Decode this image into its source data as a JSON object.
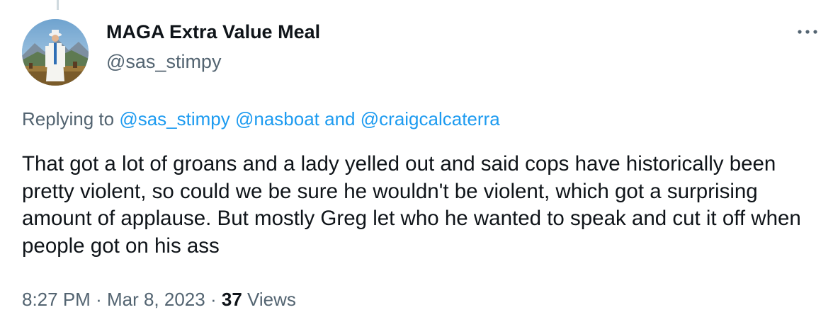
{
  "tweet": {
    "display_name": "MAGA Extra Value Meal",
    "handle": "@sas_stimpy",
    "more_icon": "ellipsis-icon",
    "replying_label": "Replying to",
    "mentions": [
      "@sas_stimpy",
      "@nasboat",
      "@craigcalcaterra"
    ],
    "mention_joiner": "and",
    "text": "That got a lot of groans and a lady yelled out and said cops have historically been pretty violent, so could we be sure he wouldn't be violent, which got a surprising amount of applause. But mostly Greg let who he wanted to speak and cut it off when people got on his ass",
    "time": "8:27 PM",
    "date": "Mar 8, 2023",
    "separator": "·",
    "views_count": "37",
    "views_label": "Views"
  },
  "colors": {
    "text_primary": "#0f1419",
    "text_secondary": "#536471",
    "link": "#1d9bf0",
    "thread_line": "#cfd9de"
  }
}
